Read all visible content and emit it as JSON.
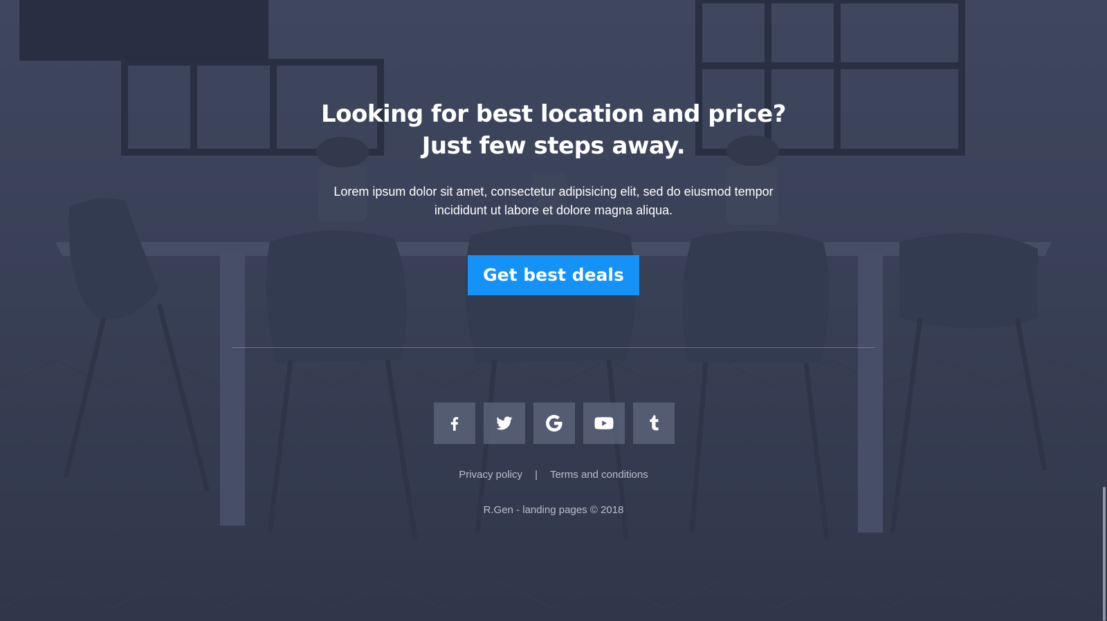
{
  "hero": {
    "headline_line1": "Looking for best location and price?",
    "headline_line2": "Just few steps away.",
    "lead_line1": "Lorem ipsum dolor sit amet, consectetur adipisicing elit, sed do eiusmod tempor",
    "lead_line2": "incididunt ut labore et dolore magna aliqua.",
    "cta_label": "Get best deals"
  },
  "footer": {
    "social": [
      {
        "name": "facebook",
        "icon": "facebook-icon"
      },
      {
        "name": "twitter",
        "icon": "twitter-icon"
      },
      {
        "name": "google",
        "icon": "google-icon"
      },
      {
        "name": "youtube",
        "icon": "youtube-icon"
      },
      {
        "name": "tumblr",
        "icon": "tumblr-icon"
      }
    ],
    "privacy_label": "Privacy policy",
    "separator": "|",
    "terms_label": "Terms and conditions",
    "copyright": "R.Gen - landing pages © 2018"
  },
  "colors": {
    "accent": "#1592f7",
    "overlay": "#282f44",
    "muted_text": "#b9bfcd",
    "text": "#ffffff"
  }
}
